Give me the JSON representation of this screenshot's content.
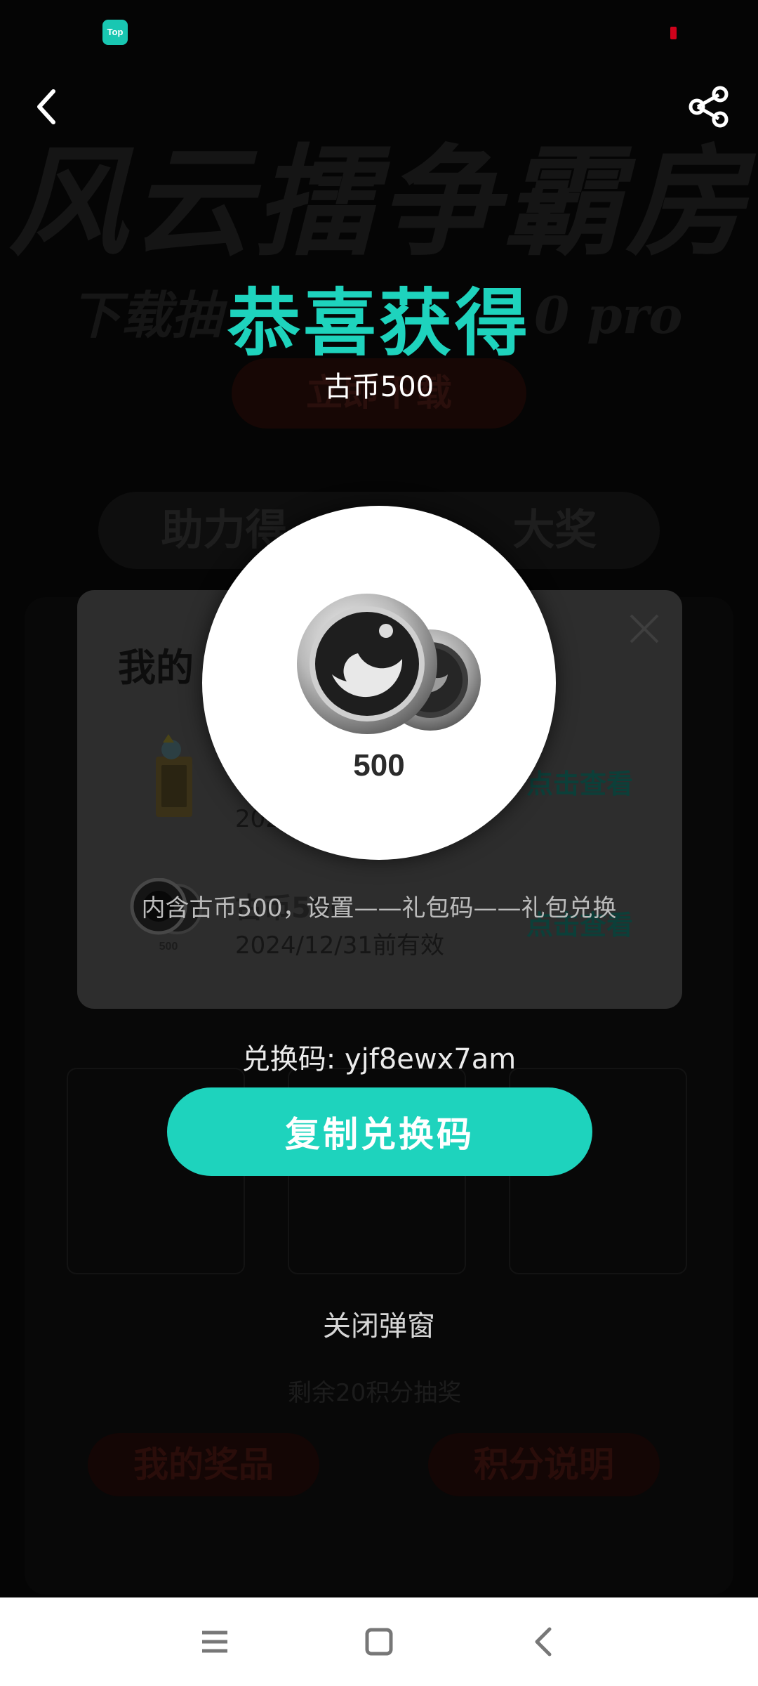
{
  "status_bar": {
    "app_icon_text": "Top"
  },
  "modal": {
    "title": "恭喜获得",
    "reward_name": "古币500",
    "coin_amount": "500",
    "description": "内含古币500，设置——礼包码——礼包兑换",
    "redeem_code_text": "兑换码: yjf8ewx7am",
    "copy_button_label": "复制兑换码",
    "close_label": "关闭弹窗"
  },
  "rewards_card": {
    "title": "我的",
    "rows": [
      {
        "name": "",
        "date": "202",
        "link": "点击查看"
      },
      {
        "name": "古币500",
        "date": "2024/12/31前有效",
        "link": "点击查看"
      }
    ]
  },
  "background": {
    "banner_text": "风云擂争霸房",
    "sub_text": "下载抽",
    "sub_text_suffix": "0 pro",
    "download_button": "立即下载",
    "help_pill": "助力得",
    "help_pill_suffix": "大奖",
    "count_text": "剩余20积分抽奖",
    "bottom_left_button": "我的奖品",
    "bottom_right_button": "积分说明"
  },
  "colors": {
    "accent": "#1ed3bd",
    "overlay_card": "#2d2d2d",
    "indicator_red": "#d0021b"
  },
  "icons": {
    "back": "back-arrow-icon",
    "share": "share-icon",
    "close": "close-icon",
    "sys_menu": "menu-icon",
    "sys_home": "home-icon",
    "sys_back": "back-triangle-icon"
  }
}
